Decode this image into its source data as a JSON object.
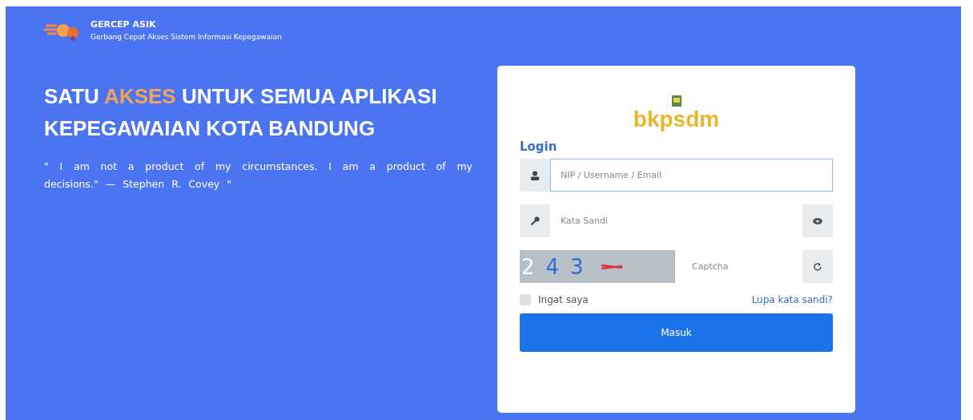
{
  "brand": {
    "name": "GERCEP ASIK",
    "tagline": "Gerbang Cepat Akses Sistem Informasi Kepegawaian"
  },
  "headline": [
    {
      "text": "SATU ",
      "highlight": false
    },
    {
      "text": "AKSES",
      "highlight": true
    },
    {
      "text": " UNTUK SEMUA APLIKASI KEPEGAWAIAN KOTA BANDUNG",
      "highlight": false
    }
  ],
  "quote": "\" I am not a product of my circumstances. I am a product of my decisions.\" — Stephen R. Covey \"",
  "login": {
    "logo": "bkpsdm",
    "title": "Login",
    "username": {
      "placeholder": "NIP / Username / Email",
      "focused": true
    },
    "password": {
      "placeholder": "Kata Sandi"
    },
    "captcha": {
      "characters": [
        "2",
        "4",
        "3"
      ],
      "placeholder": "Captcha"
    },
    "remember": {
      "label": "Ingat saya",
      "checked": false
    },
    "forgot": "Lupa kata sandi?",
    "submit": "Masuk"
  }
}
